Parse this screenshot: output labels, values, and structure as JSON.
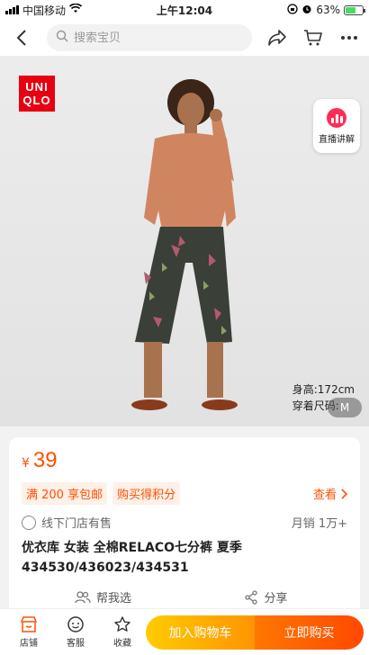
{
  "status_bar": {
    "carrier": "中国移动",
    "time": "上午12:04",
    "battery": "63%",
    "battery_level": 0.63
  },
  "nav": {
    "search_placeholder": "搜索宝贝",
    "icons": [
      "back-icon",
      "search-icon",
      "share-icon",
      "cart-icon",
      "more-icon"
    ]
  },
  "hero": {
    "brand_logo": "UNI QLO",
    "live_label": "直播讲解",
    "height_label": "身高:172cm",
    "size_label": "穿着尺码:",
    "size_value": "M"
  },
  "product": {
    "currency": "¥",
    "price": "39",
    "promo_shipping": "满 200 享包邮",
    "promo_points": "购买得积分",
    "view_label": "查看",
    "store_label": "线下门店有售",
    "monthly_sales": "月销 1万+",
    "title": "优衣库 女装 全棉RELACO七分裤 夏季 434530/436023/434531",
    "help_choose": "帮我选",
    "share": "分享"
  },
  "bottom_bar": {
    "store": "店铺",
    "service": "客服",
    "favorite": "收藏",
    "add_to_cart": "加入购物车",
    "buy_now": "立即购买"
  },
  "colors": {
    "accent": "#ff5000",
    "brand_red": "#e60012",
    "cart_btn": "#ffb400",
    "buy_btn": "#ff5a00"
  }
}
